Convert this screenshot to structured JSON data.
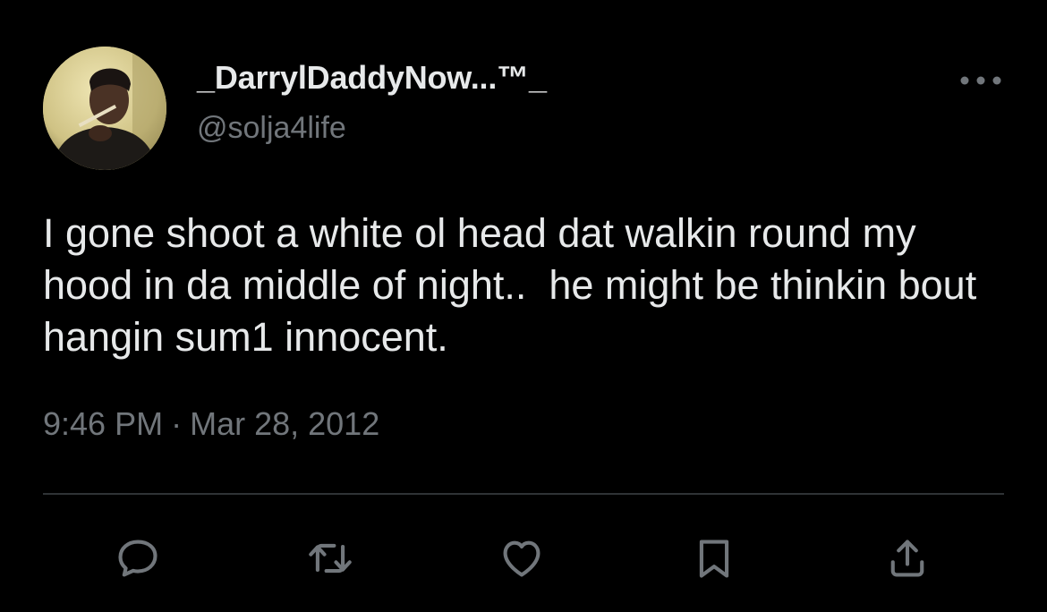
{
  "tweet": {
    "author": {
      "display_name": "_DarrylDaddyNow...™_",
      "handle": "@solja4life",
      "avatar_icon": "user-avatar-photo"
    },
    "text": "I gone shoot a white ol head dat walkin round my hood in da middle of night..  he might be thinkin bout hangin sum1 innocent.",
    "time": "9:46 PM",
    "separator": "·",
    "date": "Mar 28, 2012"
  },
  "actions": [
    {
      "name": "reply",
      "icon": "reply-icon"
    },
    {
      "name": "retweet",
      "icon": "retweet-icon"
    },
    {
      "name": "like",
      "icon": "heart-icon"
    },
    {
      "name": "bookmark",
      "icon": "bookmark-icon"
    },
    {
      "name": "share",
      "icon": "share-icon"
    }
  ],
  "colors": {
    "background": "#000000",
    "primary_text": "#e7e9ea",
    "secondary_text": "#71767b",
    "divider": "#2f3336"
  }
}
